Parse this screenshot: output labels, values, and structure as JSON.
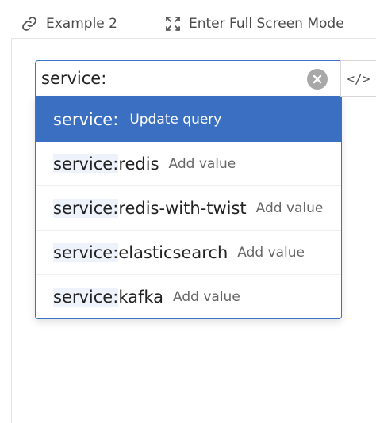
{
  "toolbar": {
    "example_label": "Example 2",
    "fullscreen_label": "Enter Full Screen Mode"
  },
  "search": {
    "value": "service:"
  },
  "code_toggle": {
    "label": "</>"
  },
  "suggestions": [
    {
      "name": "service:",
      "hint": "Update query",
      "active": true
    },
    {
      "prefix": "service:",
      "rest": "redis",
      "hint": "Add value"
    },
    {
      "prefix": "service:",
      "rest": "redis-with-twist",
      "hint": "Add value"
    },
    {
      "prefix": "service:",
      "rest": "elasticsearch",
      "hint": "Add value"
    },
    {
      "prefix": "service:",
      "rest": "kafka",
      "hint": "Add value"
    }
  ],
  "colors": {
    "accent": "#3a6fc1",
    "border_focus": "#3a73c7"
  },
  "icons": {
    "example": "link-icon",
    "fullscreen": "expand-icon",
    "clear": "clear-circle-icon"
  }
}
